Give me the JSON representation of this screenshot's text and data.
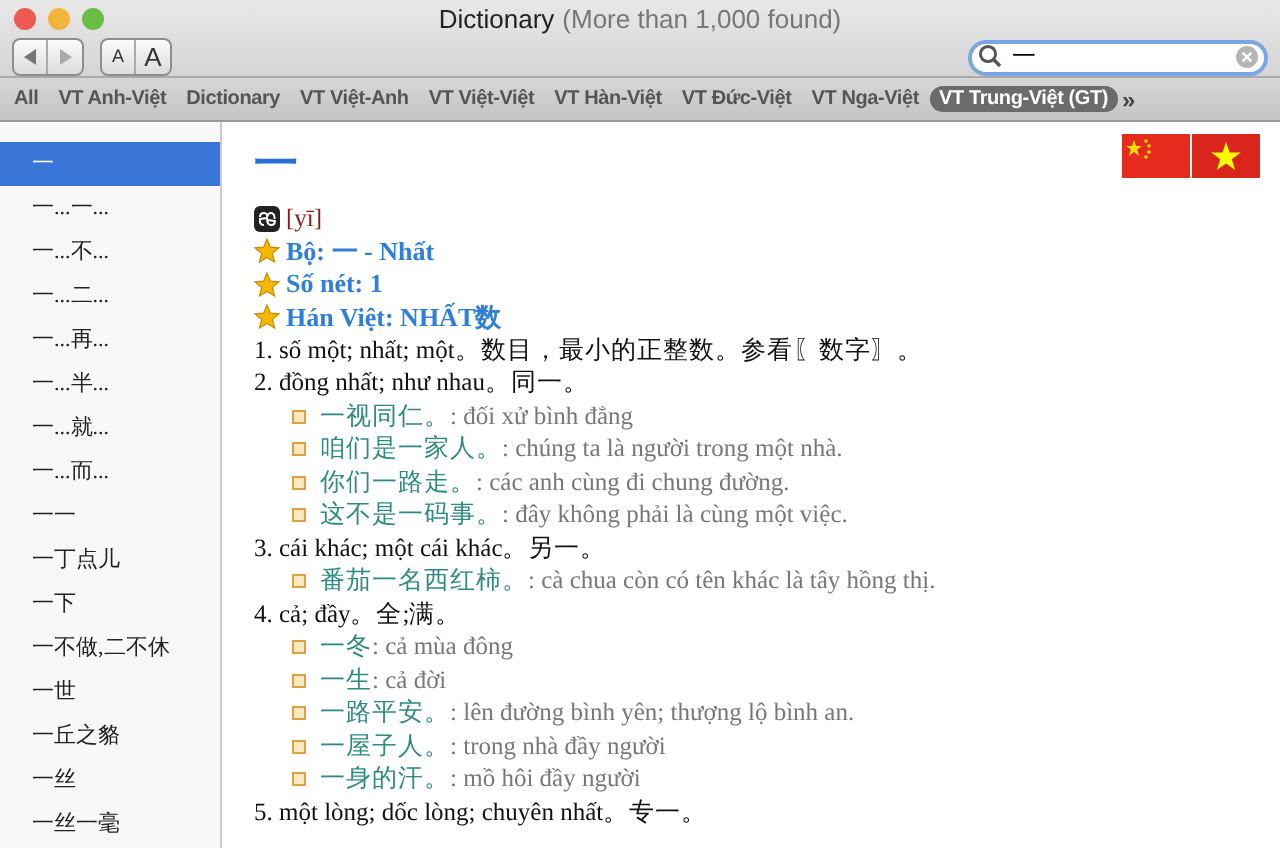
{
  "window": {
    "title": "Dictionary",
    "subtitle": "(More than 1,000 found)"
  },
  "toolbar": {
    "font_buttons": [
      "A",
      "A"
    ],
    "search": {
      "value": "一"
    }
  },
  "tabs": [
    {
      "label": "All",
      "selected": false
    },
    {
      "label": "VT Anh-Việt",
      "selected": false
    },
    {
      "label": "Dictionary",
      "selected": false
    },
    {
      "label": "VT Việt-Anh",
      "selected": false
    },
    {
      "label": "VT Việt-Việt",
      "selected": false
    },
    {
      "label": "VT Hàn-Việt",
      "selected": false
    },
    {
      "label": "VT Đức-Việt",
      "selected": false
    },
    {
      "label": "VT Nga-Việt",
      "selected": false
    },
    {
      "label": "VT Trung-Việt (GT)",
      "selected": true
    }
  ],
  "tabs_overflow": "»",
  "sidebar": {
    "items": [
      {
        "label": "一",
        "selected": true
      },
      {
        "label": "一...一...",
        "selected": false
      },
      {
        "label": "一...不...",
        "selected": false
      },
      {
        "label": "一...二...",
        "selected": false
      },
      {
        "label": "一...再...",
        "selected": false
      },
      {
        "label": "一...半...",
        "selected": false
      },
      {
        "label": "一...就...",
        "selected": false
      },
      {
        "label": "一...而...",
        "selected": false
      },
      {
        "label": "一一",
        "selected": false
      },
      {
        "label": "一丁点儿",
        "selected": false
      },
      {
        "label": "一下",
        "selected": false
      },
      {
        "label": "一不做,二不休",
        "selected": false
      },
      {
        "label": "一世",
        "selected": false
      },
      {
        "label": "一丘之貉",
        "selected": false
      },
      {
        "label": "一丝",
        "selected": false
      },
      {
        "label": "一丝一毫",
        "selected": false
      }
    ]
  },
  "entry": {
    "headword": "一",
    "pronunciation": "[yī]",
    "info": [
      "Bộ: 一 - Nhất",
      "Số nét: 1",
      "Hán Việt: NHẤT数"
    ],
    "senses": [
      {
        "text": "1. số một; nhất; một。数目，最小的正整数。参看〖数字〗。"
      },
      {
        "text": "2. đồng nhất; như nhau。同一。",
        "examples": [
          {
            "zh": "一视同仁。",
            "vi": ": đối xử bình đẳng"
          },
          {
            "zh": "咱们是一家人。",
            "vi": ": chúng ta là người trong một nhà."
          },
          {
            "zh": "你们一路走。",
            "vi": ": các anh cùng đi chung đường."
          },
          {
            "zh": "这不是一码事。",
            "vi": ": đây không phải là cùng một việc."
          }
        ]
      },
      {
        "text": "3. cái khác; một cái khác。另一。",
        "examples": [
          {
            "zh": "番茄一名西红柿。",
            "vi": ": cà chua còn có tên khác là tây hồng thị."
          }
        ]
      },
      {
        "text": "4. cả; đầy。全;满。",
        "examples": [
          {
            "zh": "一冬",
            "vi": ": cả mùa đông"
          },
          {
            "zh": "一生",
            "vi": ": cả đời"
          },
          {
            "zh": "一路平安。",
            "vi": ": lên đường bình yên; thượng lộ bình an."
          },
          {
            "zh": "一屋子人。",
            "vi": ": trong nhà đầy người"
          },
          {
            "zh": "一身的汗。",
            "vi": ": mồ hôi đầy người"
          }
        ]
      },
      {
        "text": "5. một lòng; dốc lòng; chuyên nhất。专一。"
      }
    ]
  }
}
